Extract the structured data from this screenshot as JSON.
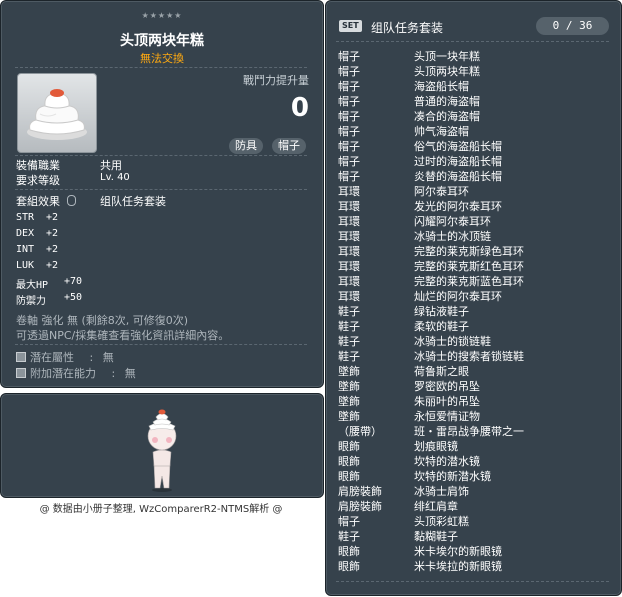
{
  "item_id": "01003419",
  "tooltip": {
    "stars": "★★★★★",
    "item_name": "头顶两块年糕",
    "trade_note": "無法交換",
    "power_label": "戰鬥力提升量",
    "power_value": "0",
    "tags": [
      "防具",
      "帽子"
    ],
    "job_label": "裝備職業",
    "job_value": "共用",
    "level_label": "要求等级",
    "level_value": "Lv. 40",
    "set_effect_label": "套組效果",
    "set_effect_value": "组队任务套装",
    "stats": [
      {
        "name": "STR",
        "value": "+2"
      },
      {
        "name": "DEX",
        "value": "+2"
      },
      {
        "name": "INT",
        "value": "+2"
      },
      {
        "name": "LUK",
        "value": "+2"
      },
      {
        "name": "最大HP",
        "value": "+70"
      },
      {
        "name": "防禦力",
        "value": "+50"
      }
    ],
    "scroll_note": "卷軸 強化 無 (剩餘8次, 可修復0次)",
    "enhance_note": "可透過NPC/採集確查看強化資訊詳細內容。",
    "potential_label": "潛在屬性",
    "potential_value": "無",
    "bonus_potential_label": "附加潛在能力",
    "bonus_potential_value": "無"
  },
  "footer_text": "@ 数据由小册子整理, WzComparerR2-NTMS解析 @",
  "set_panel": {
    "badge": "SET",
    "title": "组队任务套装",
    "count": "0 / 36",
    "items": [
      {
        "slot": "帽子",
        "name": "头顶一块年糕"
      },
      {
        "slot": "帽子",
        "name": "头顶两块年糕"
      },
      {
        "slot": "帽子",
        "name": "海盗船长帽"
      },
      {
        "slot": "帽子",
        "name": "普通的海盗帽"
      },
      {
        "slot": "帽子",
        "name": "凑合的海盗帽"
      },
      {
        "slot": "帽子",
        "name": "帅气海盗帽"
      },
      {
        "slot": "帽子",
        "name": "俗气的海盗船长帽"
      },
      {
        "slot": "帽子",
        "name": "过时的海盗船长帽"
      },
      {
        "slot": "帽子",
        "name": "炎替的海盗船长帽"
      },
      {
        "slot": "耳環",
        "name": "阿尔泰耳环"
      },
      {
        "slot": "耳環",
        "name": "发光的阿尔泰耳环"
      },
      {
        "slot": "耳環",
        "name": "闪耀阿尔泰耳环"
      },
      {
        "slot": "耳環",
        "name": "冰骑士的冰顶链"
      },
      {
        "slot": "耳環",
        "name": "完整的莱克斯绿色耳环"
      },
      {
        "slot": "耳環",
        "name": "完整的莱克斯红色耳环"
      },
      {
        "slot": "耳環",
        "name": "完整的莱克斯蓝色耳环"
      },
      {
        "slot": "耳環",
        "name": "灿烂的阿尔泰耳环"
      },
      {
        "slot": "鞋子",
        "name": "绿钻液鞋子"
      },
      {
        "slot": "鞋子",
        "name": "柔软的鞋子"
      },
      {
        "slot": "鞋子",
        "name": "冰骑士的锁链鞋"
      },
      {
        "slot": "鞋子",
        "name": "冰骑士的搜索者锁链鞋"
      },
      {
        "slot": "墜飾",
        "name": "荷鲁斯之眼"
      },
      {
        "slot": "墜飾",
        "name": "罗密欧的吊坠"
      },
      {
        "slot": "墜飾",
        "name": "朱丽叶的吊坠"
      },
      {
        "slot": "墜飾",
        "name": "永恒爱情证物"
      },
      {
        "slot": "（腰帶）",
        "name": "班・雷昂战争腰带之一"
      },
      {
        "slot": "眼飾",
        "name": "划痕眼镜"
      },
      {
        "slot": "眼飾",
        "name": "坎特的潜水镜"
      },
      {
        "slot": "眼飾",
        "name": "坎特的新潜水镜"
      },
      {
        "slot": "肩膀裝飾",
        "name": "冰骑士肩饰"
      },
      {
        "slot": "肩膀裝飾",
        "name": "绯红肩章"
      },
      {
        "slot": "帽子",
        "name": "头顶彩虹糕"
      },
      {
        "slot": "鞋子",
        "name": "黏糊鞋子"
      },
      {
        "slot": "眼飾",
        "name": "米卡埃尔的新眼镜"
      },
      {
        "slot": "眼飾",
        "name": "米卡埃拉的新眼镜"
      }
    ]
  }
}
